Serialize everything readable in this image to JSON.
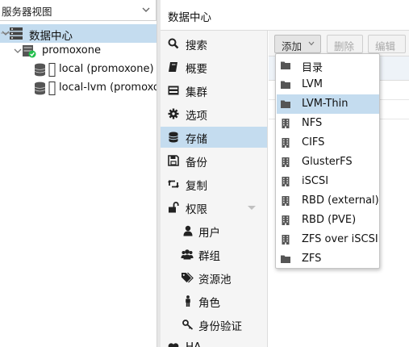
{
  "tree": {
    "view_select": "服务器视图",
    "nodes": [
      {
        "label": "数据中心",
        "icon": "datacenter-icon"
      },
      {
        "label": "promoxone",
        "icon": "server-online-icon"
      },
      {
        "label": "local (promoxone)",
        "icon": "storage-icon"
      },
      {
        "label": "local-lvm (promoxone)",
        "icon": "storage-icon"
      }
    ]
  },
  "header": {
    "title": "数据中心"
  },
  "nav": {
    "items": [
      {
        "label": "搜索",
        "icon": "search-icon"
      },
      {
        "label": "概要",
        "icon": "book-icon"
      },
      {
        "label": "集群",
        "icon": "cluster-icon"
      },
      {
        "label": "选项",
        "icon": "gear-icon"
      },
      {
        "label": "存储",
        "icon": "database-icon"
      },
      {
        "label": "备份",
        "icon": "save-icon"
      },
      {
        "label": "复制",
        "icon": "retweet-icon"
      },
      {
        "label": "权限",
        "icon": "unlock-icon"
      },
      {
        "label": "用户",
        "icon": "user-icon"
      },
      {
        "label": "群组",
        "icon": "users-icon"
      },
      {
        "label": "资源池",
        "icon": "tags-icon"
      },
      {
        "label": "角色",
        "icon": "male-icon"
      },
      {
        "label": "身份验证",
        "icon": "key-icon"
      },
      {
        "label": "HA",
        "icon": "heartbeat-icon"
      }
    ]
  },
  "toolbar": {
    "add_label": "添加",
    "delete_label": "删除",
    "edit_label": "编辑"
  },
  "menu": {
    "items": [
      {
        "label": "目录",
        "icon": "folder-icon"
      },
      {
        "label": "LVM",
        "icon": "folder-icon"
      },
      {
        "label": "LVM-Thin",
        "icon": "folder-icon"
      },
      {
        "label": "NFS",
        "icon": "building-icon"
      },
      {
        "label": "CIFS",
        "icon": "building-icon"
      },
      {
        "label": "GlusterFS",
        "icon": "building-icon"
      },
      {
        "label": "iSCSI",
        "icon": "building-icon"
      },
      {
        "label": "RBD (external)",
        "icon": "building-icon"
      },
      {
        "label": "RBD (PVE)",
        "icon": "building-icon"
      },
      {
        "label": "ZFS over iSCSI",
        "icon": "building-icon"
      },
      {
        "label": "ZFS",
        "icon": "folder-icon"
      }
    ],
    "highlighted": "LVM-Thin"
  },
  "colors": {
    "selection": "#c4dcef",
    "panel_bg": "#f5f5f5",
    "online_green": "#21bf4b",
    "icon_dark": "#333333"
  }
}
